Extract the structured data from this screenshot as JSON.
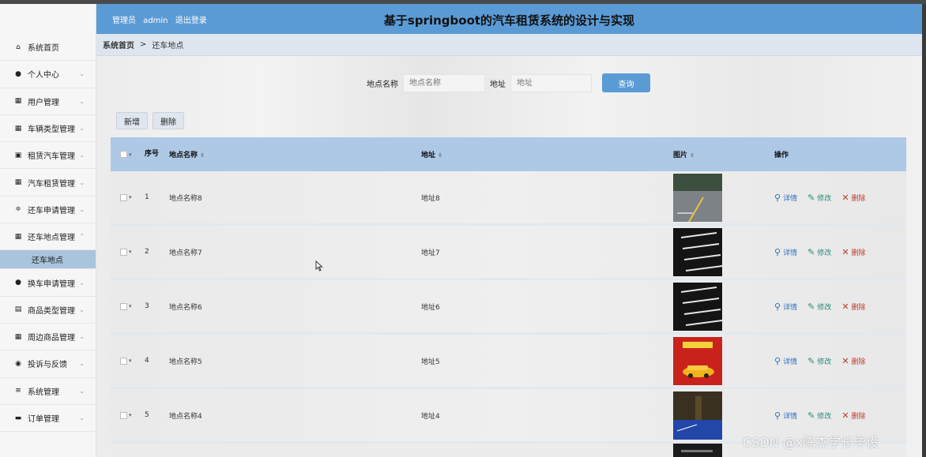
{
  "header": {
    "user_prefix": "管理员",
    "username": "admin",
    "logout_label": "退出登录",
    "title": "基于springboot的汽车租赁系统的设计与实现",
    "accent": "#5b9bd5"
  },
  "sidebar": {
    "items": [
      {
        "label": "系统首页",
        "icon": "home-icon",
        "expandable": false
      },
      {
        "label": "个人中心",
        "icon": "person-icon",
        "expandable": true
      },
      {
        "label": "用户管理",
        "icon": "grid-icon",
        "expandable": true
      },
      {
        "label": "车辆类型管理",
        "icon": "grid-icon",
        "expandable": true
      },
      {
        "label": "租赁汽车管理",
        "icon": "box-icon",
        "expandable": true
      },
      {
        "label": "汽车租赁管理",
        "icon": "grid-icon",
        "expandable": true
      },
      {
        "label": "还车申请管理",
        "icon": "sliders-icon",
        "expandable": true
      },
      {
        "label": "还车地点管理",
        "icon": "grid-icon",
        "expandable": true,
        "expanded": true
      },
      {
        "label": "换车申请管理",
        "icon": "person-icon",
        "expandable": true
      },
      {
        "label": "商品类型管理",
        "icon": "clipboard-icon",
        "expandable": true
      },
      {
        "label": "周边商品管理",
        "icon": "grid-icon",
        "expandable": true
      },
      {
        "label": "投诉与反馈",
        "icon": "pin-icon",
        "expandable": true
      },
      {
        "label": "系统管理",
        "icon": "menu-icon",
        "expandable": true
      },
      {
        "label": "订单管理",
        "icon": "printer-icon",
        "expandable": true
      }
    ],
    "sub_item": "还车地点"
  },
  "breadcrumb": {
    "home": "系统首页",
    "separator": ">",
    "current": "还车地点"
  },
  "search": {
    "name_label": "地点名称",
    "name_placeholder": "地点名称",
    "addr_label": "地址",
    "addr_placeholder": "地址",
    "button": "查询"
  },
  "toolbar": {
    "add": "新增",
    "delete": "删除"
  },
  "table": {
    "headers": {
      "index": "序号",
      "name": "地点名称",
      "address": "地址",
      "image": "图片",
      "ops": "操作"
    },
    "ops": {
      "detail": "详情",
      "edit": "修改",
      "delete": "删除"
    },
    "rows": [
      {
        "index": "1",
        "name": "地点名称8",
        "address": "地址8",
        "image": "parking-lot-photo"
      },
      {
        "index": "2",
        "name": "地点名称7",
        "address": "地址7",
        "image": "parking-lines-dark-photo"
      },
      {
        "index": "3",
        "name": "地点名称6",
        "address": "地址6",
        "image": "parking-lines-dark-photo"
      },
      {
        "index": "4",
        "name": "地点名称5",
        "address": "地址5",
        "image": "car-poster-red-photo"
      },
      {
        "index": "5",
        "name": "地点名称4",
        "address": "地址4",
        "image": "garage-blue-floor-photo"
      }
    ]
  },
  "watermark": "CSDN @x陈杰学长毕设"
}
